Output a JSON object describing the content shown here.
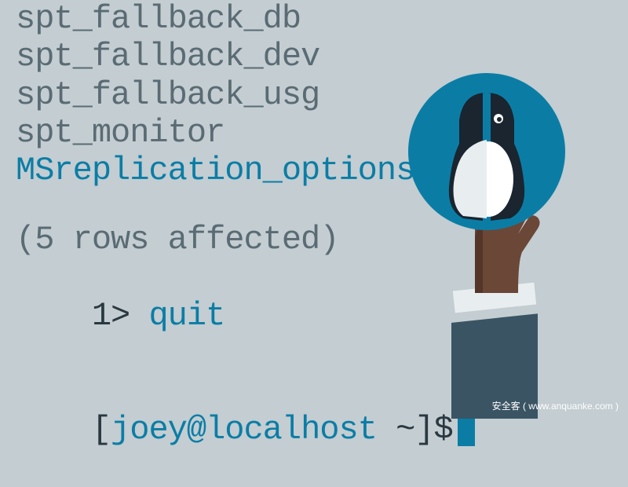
{
  "terminal": {
    "rows": [
      "spt_fallback_db",
      "spt_fallback_dev",
      "spt_fallback_usg",
      "spt_monitor",
      "MSreplication_options"
    ],
    "result_msg": "(5 rows affected)",
    "prompt_num": "1>",
    "command": "quit",
    "shell_open": "[",
    "shell_userhost": "joey@localhost ",
    "shell_tail": "~]$"
  },
  "watermark": "安全客 ( www.anquanke.com )",
  "colors": {
    "bg": "#c3cdd2",
    "blue": "#0b7da5",
    "gray": "#5a6b73",
    "dark": "#2a3840"
  }
}
